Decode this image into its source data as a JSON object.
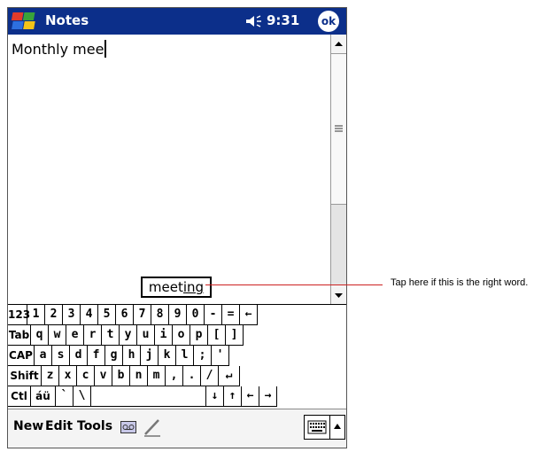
{
  "titlebar": {
    "app_title": "Notes",
    "time": "9:31",
    "ok_label": "ok",
    "start_icon": "windows-flag-icon",
    "speaker_icon": "speaker-icon"
  },
  "note": {
    "text": "Monthly mee"
  },
  "suggestion": {
    "typed": "meet",
    "completion": "ing"
  },
  "keyboard": {
    "rows": [
      [
        "123",
        "1",
        "2",
        "3",
        "4",
        "5",
        "6",
        "7",
        "8",
        "9",
        "0",
        "-",
        "=",
        "←"
      ],
      [
        "Tab",
        "q",
        "w",
        "e",
        "r",
        "t",
        "y",
        "u",
        "i",
        "o",
        "p",
        "[",
        "]"
      ],
      [
        "CAP",
        "a",
        "s",
        "d",
        "f",
        "g",
        "h",
        "j",
        "k",
        "l",
        ";",
        "'"
      ],
      [
        "Shift",
        "z",
        "x",
        "c",
        "v",
        "b",
        "n",
        "m",
        ",",
        ".",
        "/",
        "↵"
      ],
      [
        "Ctl",
        "áü",
        "`",
        "\\",
        "",
        "↓",
        "↑",
        "←",
        "→"
      ]
    ]
  },
  "menubar": {
    "new": "New",
    "edit": "Edit",
    "tools": "Tools"
  },
  "callout": {
    "text": "Tap here if this is the right word."
  },
  "colors": {
    "titlebar": "#0c2f8a",
    "callout_line": "#cc2222"
  }
}
